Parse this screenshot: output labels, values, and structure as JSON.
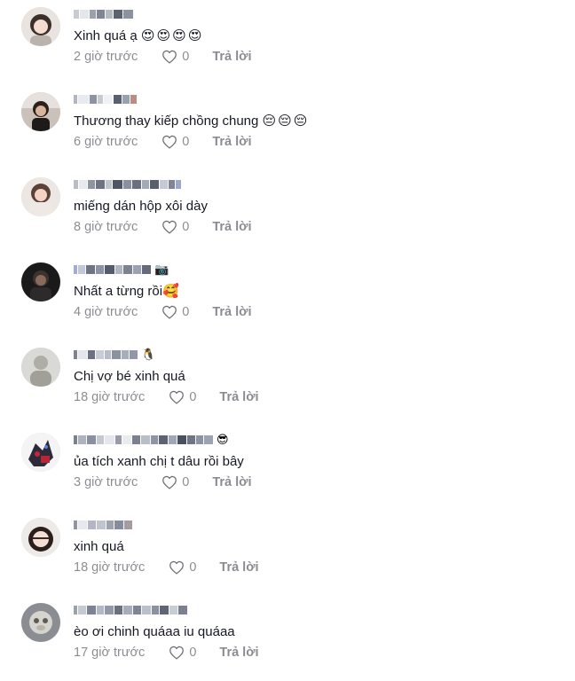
{
  "comments": [
    {
      "text": "Xinh quá ạ",
      "emoji": "😍😍😍😍",
      "time": "2 giờ trước",
      "likes": "0",
      "reply": "Trả lời",
      "username_emoji": ""
    },
    {
      "text": "Thương thay kiếp chồng chung",
      "emoji": "😔😔😔",
      "time": "6 giờ trước",
      "likes": "0",
      "reply": "Trả lời",
      "username_emoji": ""
    },
    {
      "text": "miếng dán hộp xôi dày",
      "emoji": "",
      "time": "8 giờ trước",
      "likes": "0",
      "reply": "Trả lời",
      "username_emoji": ""
    },
    {
      "text": "Nhất a từng rồi",
      "emoji": "🥰",
      "time": "4 giờ trước",
      "likes": "0",
      "reply": "Trả lời",
      "username_emoji": "📷"
    },
    {
      "text": "Chị vợ bé xinh quá",
      "emoji": "",
      "time": "18 giờ trước",
      "likes": "0",
      "reply": "Trả lời",
      "username_emoji": "🐧"
    },
    {
      "text": "ủa tích xanh chị t dâu rồi bây",
      "emoji": "",
      "time": "3 giờ trước",
      "likes": "0",
      "reply": "Trả lời",
      "username_emoji": "😎"
    },
    {
      "text": "xinh quá",
      "emoji": "",
      "time": "18 giờ trước",
      "likes": "0",
      "reply": "Trả lời",
      "username_emoji": ""
    },
    {
      "text": "èo ơi chinh quáaa iu quáaa",
      "emoji": "",
      "time": "17 giờ trước",
      "likes": "0",
      "reply": "Trả lời",
      "username_emoji": ""
    }
  ]
}
